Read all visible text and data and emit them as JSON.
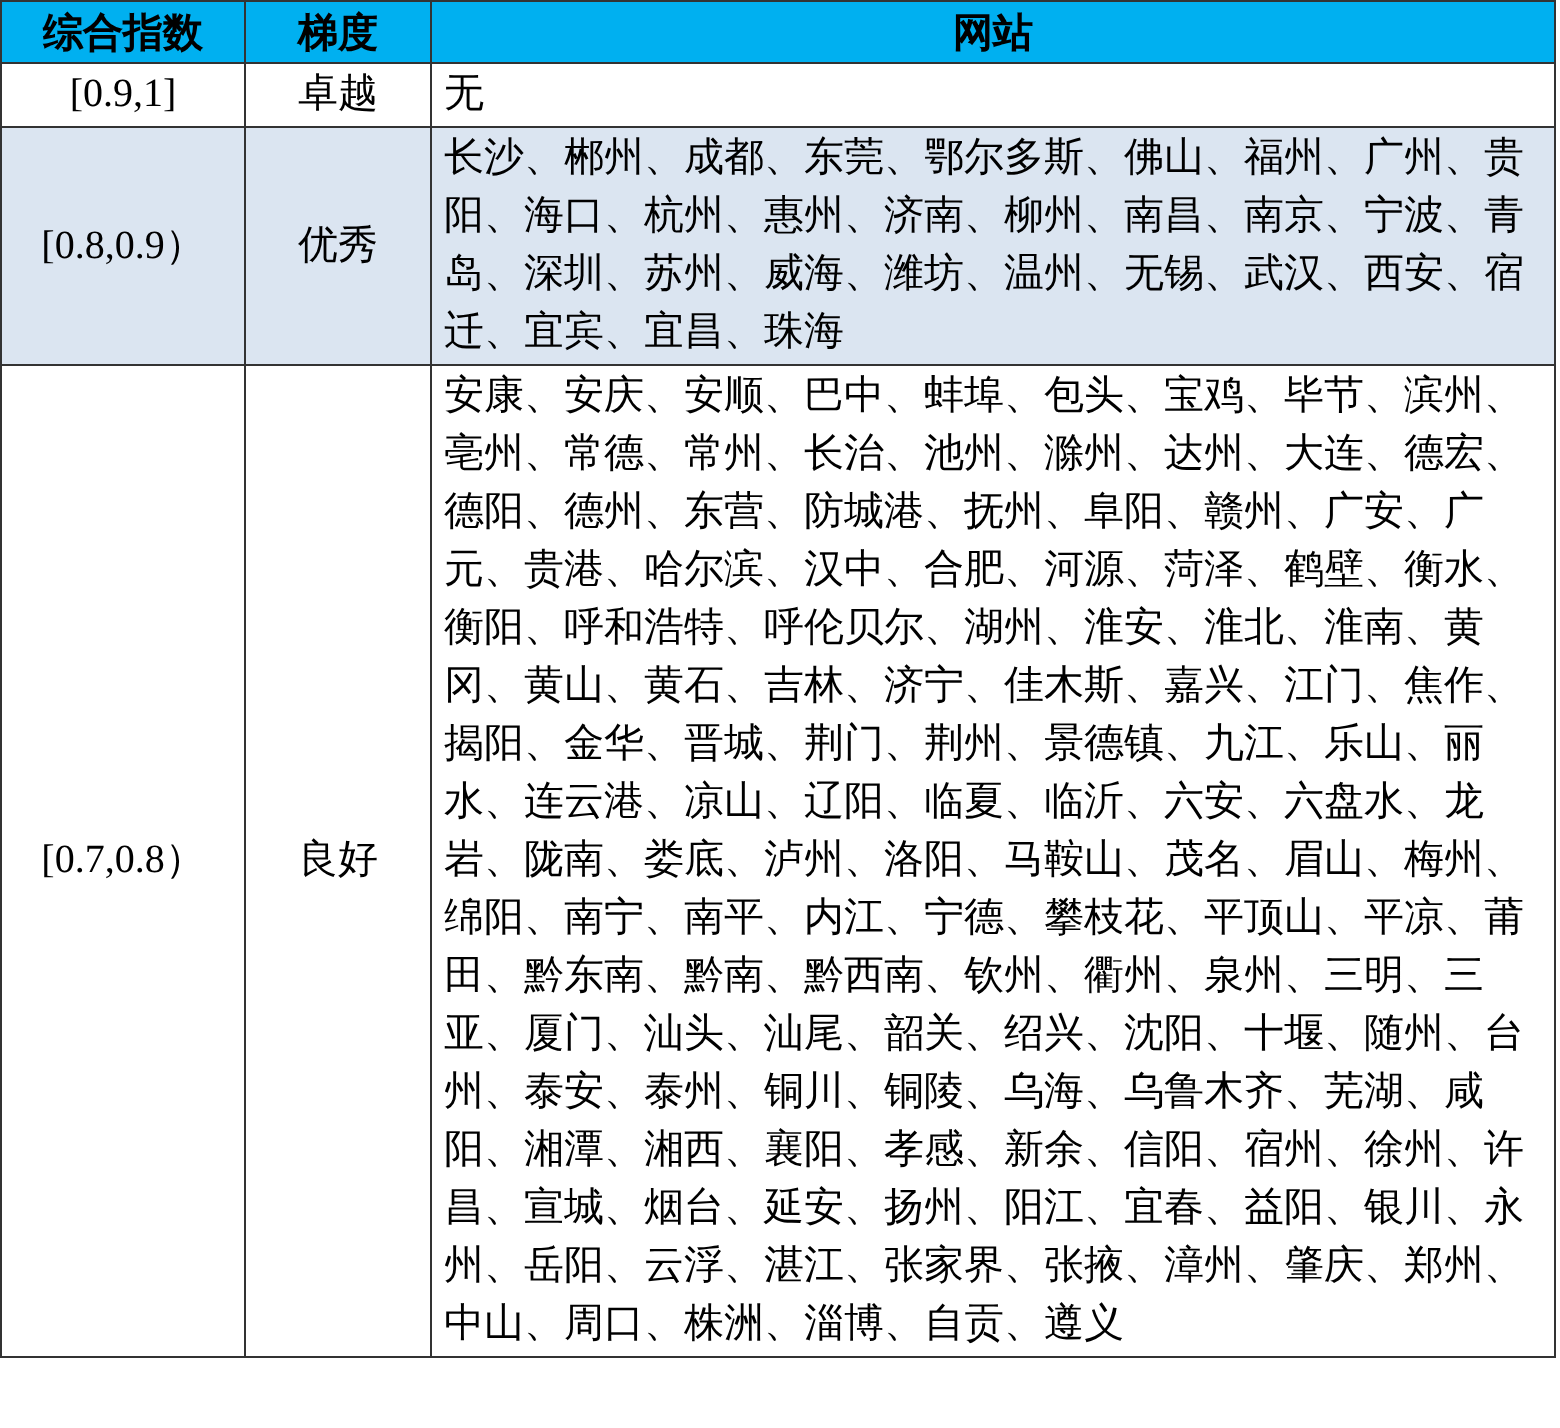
{
  "table": {
    "columns": [
      "综合指数",
      "梯度",
      "网站"
    ],
    "rows": [
      {
        "index": "[0.9,1]",
        "grade": "卓越",
        "sites": "无",
        "shaded": false
      },
      {
        "index": "[0.8,0.9）",
        "grade": "优秀",
        "sites": "长沙、郴州、成都、东莞、鄂尔多斯、佛山、福州、广州、贵阳、海口、杭州、惠州、济南、柳州、南昌、南京、宁波、青岛、深圳、苏州、威海、潍坊、温州、无锡、武汉、西安、宿迁、宜宾、宜昌、珠海",
        "shaded": true
      },
      {
        "index": "[0.7,0.8）",
        "grade": "良好",
        "sites": "安康、安庆、安顺、巴中、蚌埠、包头、宝鸡、毕节、滨州、亳州、常德、常州、长治、池州、滁州、达州、大连、德宏、德阳、德州、东营、防城港、抚州、阜阳、赣州、广安、广元、贵港、哈尔滨、汉中、合肥、河源、菏泽、鹤壁、衡水、衡阳、呼和浩特、呼伦贝尔、湖州、淮安、淮北、淮南、黄冈、黄山、黄石、吉林、济宁、佳木斯、嘉兴、江门、焦作、揭阳、金华、晋城、荆门、荆州、景德镇、九江、乐山、丽水、连云港、凉山、辽阳、临夏、临沂、六安、六盘水、龙岩、陇南、娄底、泸州、洛阳、马鞍山、茂名、眉山、梅州、绵阳、南宁、南平、内江、宁德、攀枝花、平顶山、平凉、莆田、黔东南、黔南、黔西南、钦州、衢州、泉州、三明、三亚、厦门、汕头、汕尾、韶关、绍兴、沈阳、十堰、随州、台州、泰安、泰州、铜川、铜陵、乌海、乌鲁木齐、芜湖、咸阳、湘潭、湘西、襄阳、孝感、新余、信阳、宿州、徐州、许昌、宣城、烟台、延安、扬州、阳江、宜春、益阳、银川、永州、岳阳、云浮、湛江、张家界、张掖、漳州、肇庆、郑州、中山、周口、株洲、淄博、自贡、遵义",
        "shaded": false
      }
    ]
  }
}
